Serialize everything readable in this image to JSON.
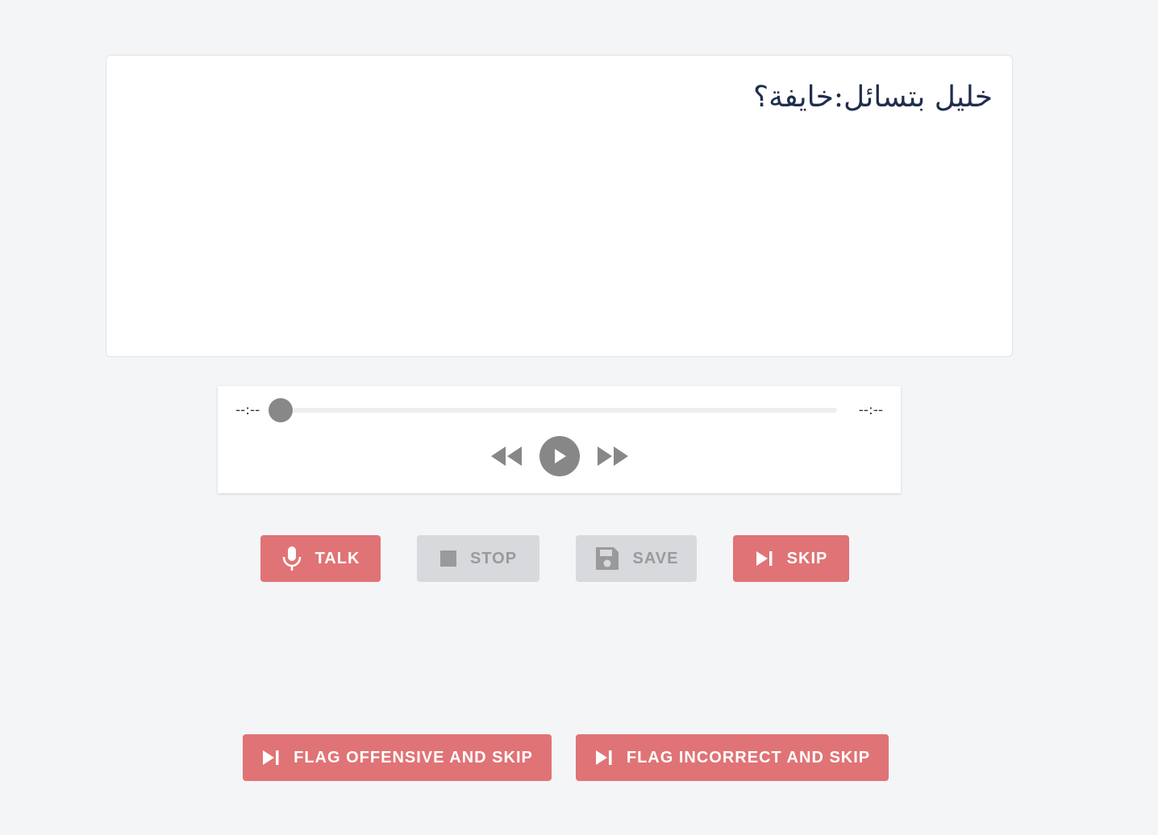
{
  "prompt": {
    "text": "خليل بتسائل:خايفة؟"
  },
  "player": {
    "current_time": "--:--",
    "total_time": "--:--",
    "progress": 0
  },
  "buttons": {
    "talk": "TALK",
    "stop": "STOP",
    "save": "SAVE",
    "skip": "SKIP",
    "flag_offensive": "FLAG OFFENSIVE AND SKIP",
    "flag_incorrect": "FLAG INCORRECT AND SKIP"
  },
  "icons": {
    "talk": "microphone-icon",
    "stop": "stop-icon",
    "save": "save-icon",
    "skip": "skip-next-icon",
    "rewind": "rewind-icon",
    "play": "play-icon",
    "forward": "fast-forward-icon"
  },
  "colors": {
    "accent": "#e07375",
    "disabled": "#d8d9dc",
    "background": "#f4f5f7",
    "text": "#1f2d4d"
  }
}
